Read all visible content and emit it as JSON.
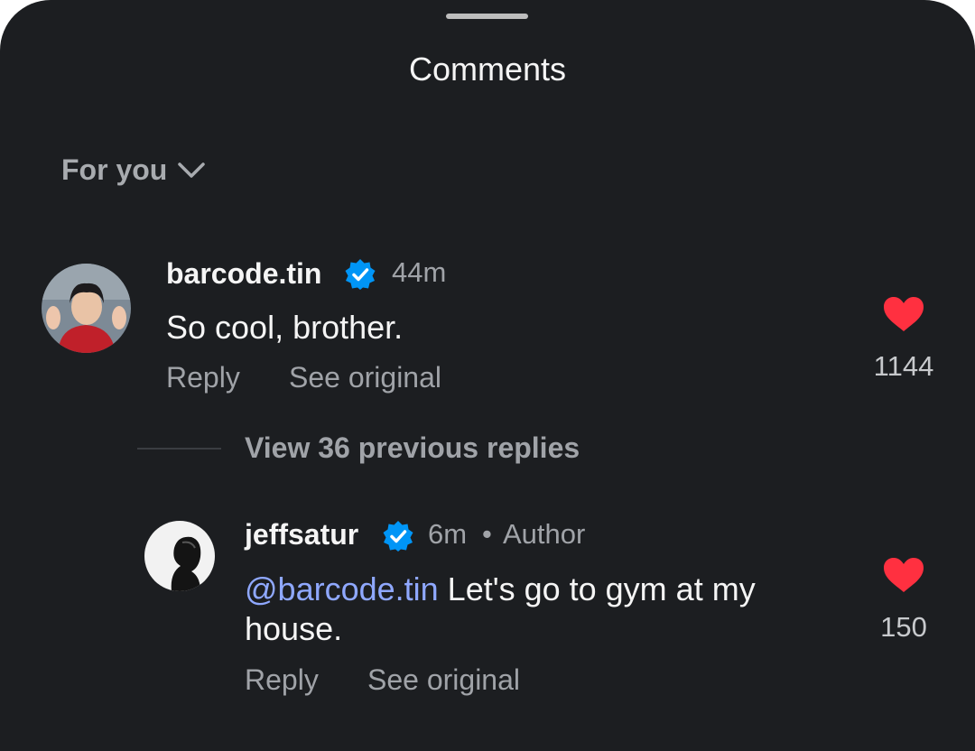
{
  "header": {
    "title": "Comments"
  },
  "sort": {
    "label": "For you"
  },
  "comments": [
    {
      "username": "barcode.tin",
      "verified": true,
      "time": "44m",
      "text": "So cool, brother.",
      "reply_label": "Reply",
      "see_original_label": "See original",
      "likes": "1144"
    }
  ],
  "view_replies": {
    "label": "View 36 previous replies"
  },
  "replies": [
    {
      "username": "jeffsatur",
      "verified": true,
      "time": "6m",
      "separator": "•",
      "badge": "Author",
      "mention": "@barcode.tin",
      "text_line1": " Let's go to gym at my",
      "text_line2": "house.",
      "reply_label": "Reply",
      "see_original_label": "See original",
      "likes": "150"
    }
  ],
  "colors": {
    "background": "#1c1e21",
    "heart": "#ff3040",
    "verified": "#0095f6",
    "mention": "#8fa8ff"
  },
  "icons": [
    "chevron-down-icon",
    "verified-badge-icon",
    "heart-icon"
  ]
}
